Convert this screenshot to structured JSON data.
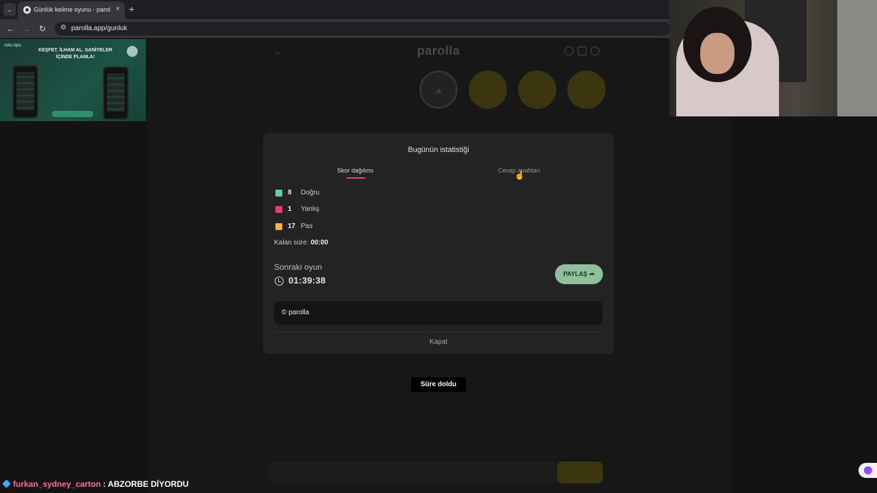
{
  "browser": {
    "tab_title": "Günlük kelime oyunu - parolla",
    "tab_close": "×",
    "new_tab": "+",
    "tab_list": "⌄",
    "back": "←",
    "forward": "→",
    "reload": "↻",
    "site_info": "⚙",
    "url": "parolla.app/gunluk"
  },
  "ad": {
    "logo": "roto.tips",
    "headline": "KEŞFET. İLHAM AL. SANİYELER İÇİNDE PLANLA!"
  },
  "game_bg": {
    "back": "←",
    "logo": "parolla",
    "first_letter": "A"
  },
  "modal": {
    "title": "Bugünün istatistiği",
    "tabs": {
      "score": "Skor dağılımı",
      "answers": "Cevap anahtarı"
    },
    "stats": [
      {
        "value": "8",
        "label": "Doğru",
        "color": "#5ed39a"
      },
      {
        "value": "1",
        "label": "Yanlış",
        "color": "#e0406a"
      },
      {
        "value": "17",
        "label": "Pas",
        "color": "#f4b24a"
      }
    ],
    "remaining_label": "Kalan süre:",
    "remaining_value": "00:00",
    "next_game_label": "Sonraki oyun",
    "countdown": "01:39:38",
    "share_label": "PAYLAŞ",
    "share_icon": "➦",
    "brand": "© parolla",
    "close_label": "Kapat"
  },
  "toast": "Süre doldu",
  "chat": {
    "user": "furkan_sydney_carton",
    "separator": " : ",
    "message": "ABZORBE DİYORDU"
  }
}
